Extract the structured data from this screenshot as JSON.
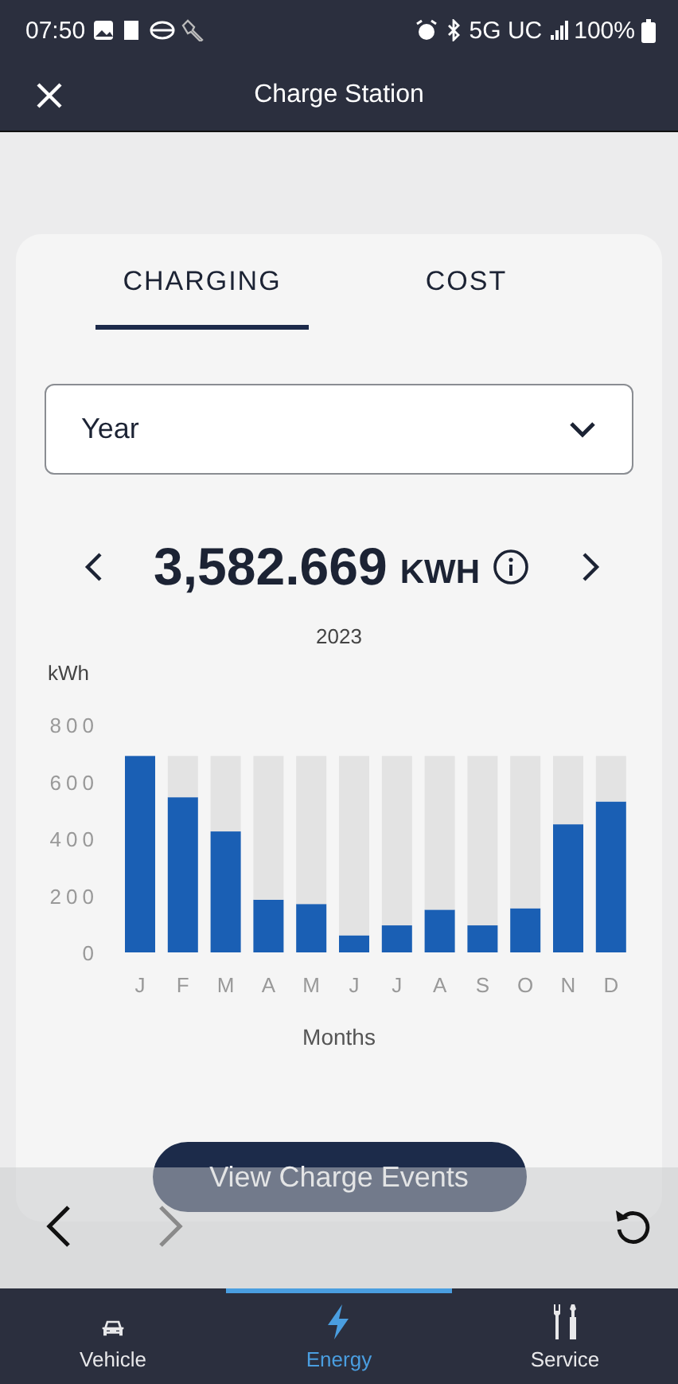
{
  "status_bar": {
    "time": "07:50",
    "network": "5G UC",
    "battery": "100%"
  },
  "header": {
    "title": "Charge Station"
  },
  "tabs": [
    {
      "label": "CHARGING",
      "selected": true
    },
    {
      "label": "COST",
      "selected": false
    }
  ],
  "period_select": {
    "value": "Year"
  },
  "total": {
    "value": "3,582.669",
    "unit": "KWH",
    "year": "2023"
  },
  "chart_data": {
    "type": "bar",
    "ylabel": "kWh",
    "xlabel": "Months",
    "categories": [
      "J",
      "F",
      "M",
      "A",
      "M",
      "J",
      "J",
      "A",
      "S",
      "O",
      "N",
      "D"
    ],
    "stacked": true,
    "series": [
      {
        "color": "#1a5fb4",
        "values": [
          690,
          545,
          425,
          185,
          170,
          60,
          95,
          150,
          95,
          155,
          450,
          530
        ]
      },
      {
        "color": "#e3e3e3",
        "values": [
          0,
          145,
          265,
          505,
          520,
          630,
          595,
          540,
          595,
          535,
          240,
          160
        ]
      }
    ],
    "ylim": [
      0,
      800
    ],
    "yticks": [
      0,
      200,
      400,
      600,
      800
    ]
  },
  "action_button": {
    "label": "View Charge Events"
  },
  "browser_toolbar": {
    "back_disabled": false,
    "forward_disabled": true
  },
  "nav": [
    {
      "label": "Vehicle",
      "kind": "car",
      "selected": false
    },
    {
      "label": "Energy",
      "kind": "bolt",
      "selected": true
    },
    {
      "label": "Service",
      "kind": "tools",
      "selected": false
    }
  ]
}
